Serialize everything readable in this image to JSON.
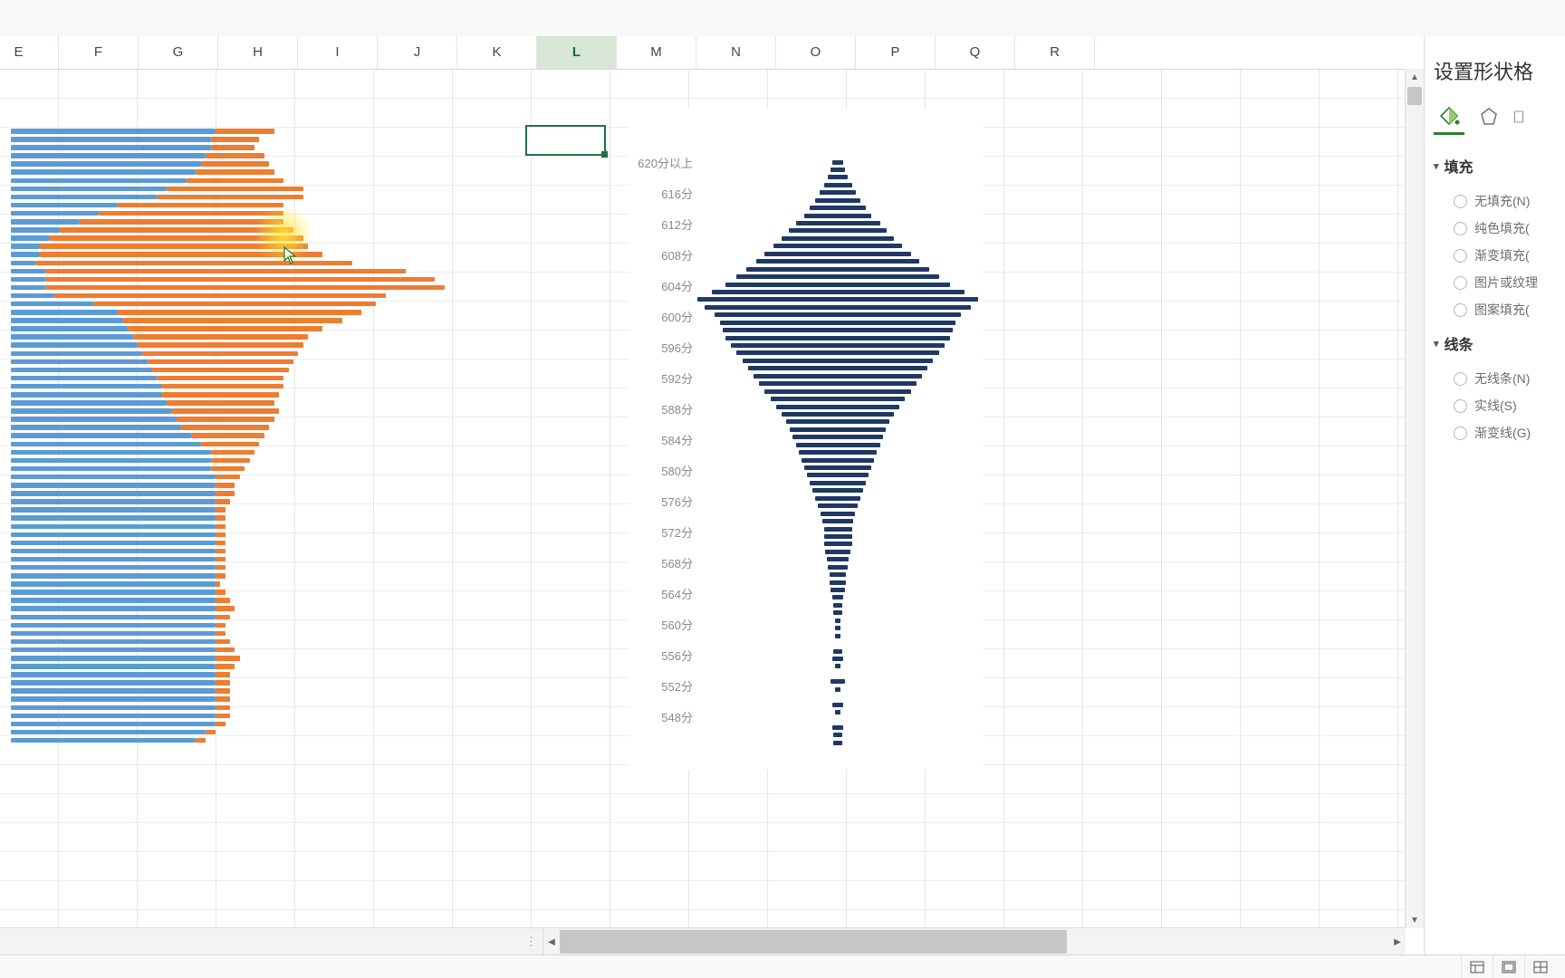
{
  "columns": [
    "E",
    "F",
    "G",
    "H",
    "I",
    "J",
    "K",
    "L",
    "M",
    "N",
    "O",
    "P",
    "Q",
    "R"
  ],
  "active_column": "L",
  "format_pane": {
    "title": "设置形状格",
    "fill_section": "填充",
    "fill_options": [
      "无填充(N)",
      "纯色填充(",
      "渐变填充(",
      "图片或纹理",
      "图案填充("
    ],
    "line_section": "线条",
    "line_options": [
      "无线条(N)",
      "实线(S)",
      "渐变线(G)"
    ]
  },
  "chart_data": [
    {
      "type": "bar",
      "name": "left-stacked-bar",
      "note": "orientation horizontal, two series; values are approximate bar widths in percent of plot width",
      "series": [
        {
          "name": "blue",
          "values": [
            42,
            41,
            41,
            40,
            39,
            38,
            36,
            32,
            30,
            22,
            18,
            14,
            10,
            8,
            6,
            6,
            5,
            7,
            7,
            7,
            9,
            17,
            22,
            23,
            24,
            25,
            26,
            27,
            28,
            29,
            30,
            31,
            31,
            32,
            33,
            34,
            35,
            37,
            39,
            41,
            41,
            41,
            42,
            42,
            42,
            42,
            42,
            42,
            42,
            42,
            42,
            42,
            42,
            42,
            42,
            42,
            42,
            42,
            42,
            42,
            42,
            42,
            42,
            42,
            42,
            42,
            42,
            42,
            42,
            42,
            42,
            42,
            42,
            40,
            38
          ]
        },
        {
          "name": "orange",
          "values": [
            12,
            10,
            9,
            12,
            14,
            16,
            20,
            28,
            30,
            34,
            38,
            42,
            48,
            52,
            55,
            58,
            65,
            74,
            80,
            82,
            68,
            58,
            50,
            45,
            40,
            36,
            34,
            32,
            30,
            28,
            26,
            25,
            24,
            22,
            22,
            20,
            18,
            15,
            12,
            9,
            8,
            7,
            5,
            4,
            4,
            3,
            2,
            2,
            2,
            2,
            2,
            2,
            2,
            2,
            2,
            1,
            2,
            3,
            4,
            3,
            2,
            2,
            3,
            4,
            5,
            4,
            3,
            3,
            3,
            3,
            3,
            3,
            2,
            2,
            2
          ]
        }
      ]
    },
    {
      "type": "bar",
      "name": "right-spindle",
      "note": "orientation horizontal, symmetric centered bars; y-axis descending from 620 to about 540 by 1; label_step 4; values are half-width percent of plot width",
      "y_axis_labels": [
        "620分以上",
        "616分",
        "612分",
        "608分",
        "604分",
        "600分",
        "596分",
        "592分",
        "588分",
        "584分",
        "580分",
        "576分",
        "572分",
        "568分",
        "564分",
        "560分",
        "556分",
        "552分",
        "548分"
      ],
      "series": [
        {
          "name": "navy",
          "color": "#1F3864",
          "values": [
            4,
            5,
            7,
            10,
            13,
            16,
            20,
            24,
            30,
            35,
            40,
            46,
            52,
            58,
            65,
            72,
            80,
            90,
            100,
            95,
            88,
            84,
            82,
            80,
            76,
            72,
            68,
            64,
            60,
            56,
            52,
            48,
            44,
            40,
            37,
            34,
            32,
            30,
            28,
            26,
            24,
            22,
            20,
            18,
            16,
            14,
            12,
            11,
            10,
            10,
            10,
            9,
            8,
            7,
            6,
            6,
            5,
            4,
            3,
            3,
            2,
            2,
            2,
            0,
            3,
            4,
            2,
            0,
            5,
            2,
            0,
            4,
            2,
            0,
            4,
            3,
            3
          ]
        }
      ]
    }
  ]
}
